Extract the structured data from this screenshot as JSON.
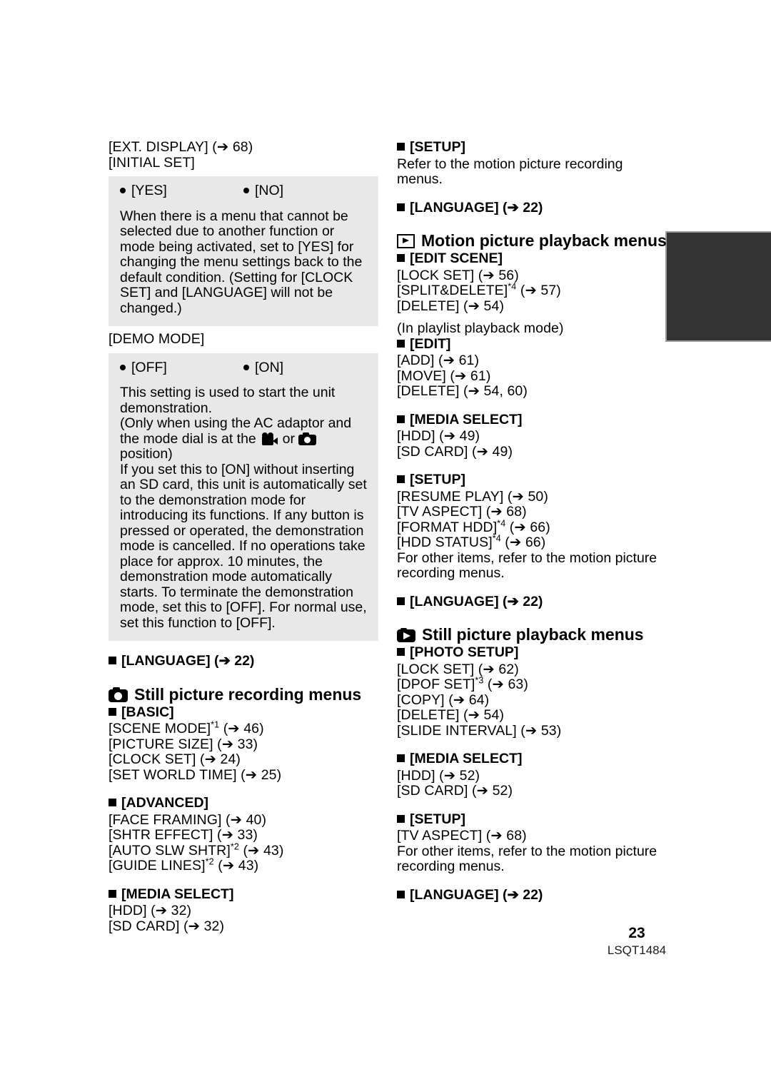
{
  "document": {
    "page_number": "23",
    "part_number": "LSQT1484"
  },
  "left_column": {
    "ext_display": "[EXT. DISPLAY] (➔ 68)",
    "initial_set": "[INITIAL SET]",
    "initial_set_box": {
      "option_yes": "[YES]",
      "option_no": "[NO]",
      "description": "When there is a menu that cannot be selected due to another function or mode being activated, set to [YES] for changing the menu settings back to the default condition. (Setting for [CLOCK SET] and [LANGUAGE] will not be changed.)"
    },
    "demo_mode": "[DEMO MODE]",
    "demo_mode_box": {
      "option_off": "[OFF]",
      "option_on": "[ON]",
      "description_part1": "This setting is used to start the unit demonstration.",
      "description_part2_pre": "(Only when using the AC adaptor and the mode dial is at the ",
      "description_part2_mid": " or ",
      "description_part2_post": " position)",
      "description_part3": "If you set this to [ON] without inserting an SD card, this unit is automatically set to the demonstration mode for introducing its functions. If any button is pressed or operated, the demonstration mode is cancelled. If no operations take place for approx. 10 minutes, the demonstration mode automatically starts. To terminate the demonstration mode, set this to [OFF]. For normal use, set this function to [OFF]."
    },
    "language_heading": "[LANGUAGE] (➔ 22)",
    "still_picture_recording_title": "Still picture recording menus",
    "basic": {
      "heading": "[BASIC]",
      "items": [
        "[SCENE MODE]*1 (➔ 46)",
        "[PICTURE SIZE] (➔ 33)",
        "[CLOCK SET] (➔ 24)",
        "[SET WORLD TIME] (➔ 25)"
      ]
    },
    "advanced": {
      "heading": "[ADVANCED]",
      "items": [
        "[FACE FRAMING] (➔ 40)",
        "[SHTR EFFECT] (➔ 33)",
        "[AUTO SLW SHTR]*2 (➔ 43)",
        "[GUIDE LINES]*2 (➔ 43)"
      ]
    },
    "media_select": {
      "heading": "[MEDIA SELECT]",
      "items": [
        "[HDD] (➔ 32)",
        "[SD CARD] (➔ 32)"
      ]
    }
  },
  "right_column": {
    "setup_top": {
      "heading": "[SETUP]",
      "note": "Refer to the motion picture recording menus."
    },
    "language_heading_1": "[LANGUAGE] (➔ 22)",
    "motion_picture_playback_title": "Motion picture playback menus",
    "edit_scene": {
      "heading": "[EDIT SCENE]",
      "items": [
        "[LOCK SET] (➔ 56)",
        "[SPLIT&DELETE]*4 (➔ 57)",
        "[DELETE] (➔ 54)"
      ],
      "note": "(In playlist playback mode)"
    },
    "edit": {
      "heading": "[EDIT]",
      "items": [
        "[ADD] (➔ 61)",
        "[MOVE] (➔ 61)",
        "[DELETE] (➔ 54, 60)"
      ]
    },
    "media_select_1": {
      "heading": "[MEDIA SELECT]",
      "items": [
        "[HDD] (➔ 49)",
        "[SD CARD] (➔ 49)"
      ]
    },
    "setup_mid": {
      "heading": "[SETUP]",
      "items": [
        "[RESUME PLAY] (➔ 50)",
        "[TV ASPECT] (➔ 68)",
        "[FORMAT HDD]*4 (➔ 66)",
        "[HDD STATUS]*4 (➔ 66)"
      ],
      "note": "For other items, refer to the motion picture recording menus."
    },
    "language_heading_2": "[LANGUAGE] (➔ 22)",
    "still_picture_playback_title": "Still picture playback menus",
    "photo_setup": {
      "heading": "[PHOTO SETUP]",
      "items": [
        "[LOCK SET] (➔ 62)",
        "[DPOF SET]*3 (➔ 63)",
        "[COPY] (➔ 64)",
        "[DELETE] (➔ 54)",
        "[SLIDE INTERVAL] (➔ 53)"
      ]
    },
    "media_select_2": {
      "heading": "[MEDIA SELECT]",
      "items": [
        "[HDD] (➔ 52)",
        "[SD CARD] (➔ 52)"
      ]
    },
    "setup_bottom": {
      "heading": "[SETUP]",
      "items": [
        "[TV ASPECT] (➔ 68)"
      ],
      "note": "For other items, refer to the motion picture recording menus."
    },
    "language_heading_3": "[LANGUAGE] (➔ 22)"
  }
}
